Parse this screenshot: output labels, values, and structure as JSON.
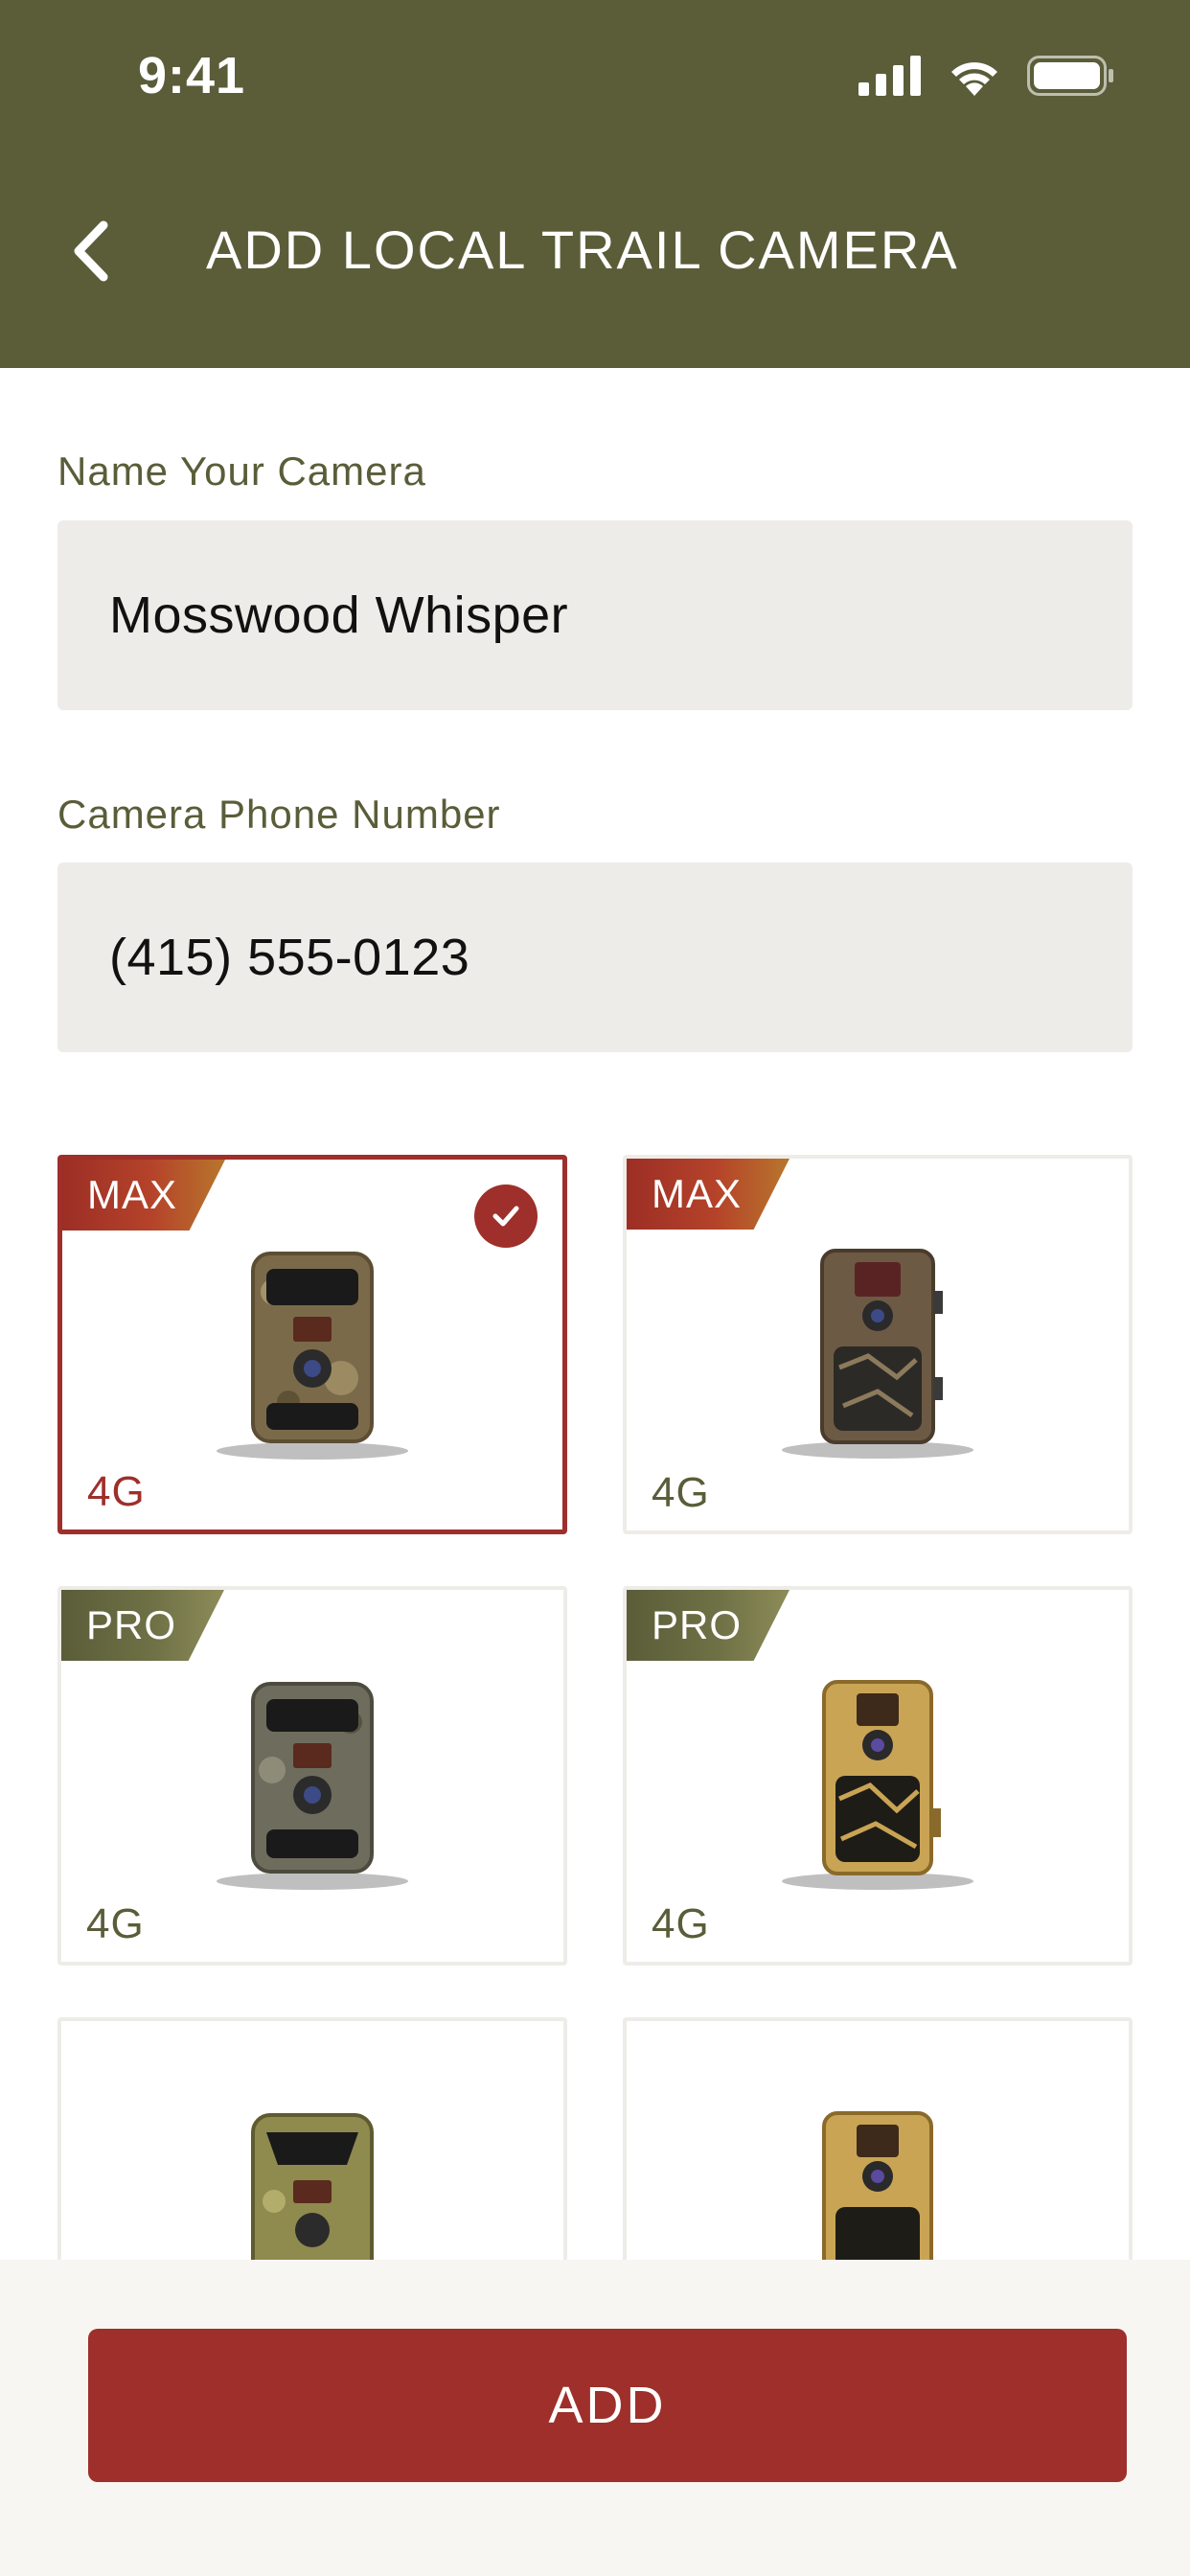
{
  "status_bar": {
    "time": "9:41"
  },
  "header": {
    "title": "ADD LOCAL TRAIL CAMERA"
  },
  "form": {
    "name_label": "Name Your Camera",
    "name_value": "Mosswood Whisper",
    "phone_label": "Camera Phone Number",
    "phone_value": "(415) 555-0123"
  },
  "cameras": [
    {
      "badge": "MAX",
      "network": "4G",
      "selected": true
    },
    {
      "badge": "MAX",
      "network": "4G",
      "selected": false
    },
    {
      "badge": "PRO",
      "network": "4G",
      "selected": false
    },
    {
      "badge": "PRO",
      "network": "4G",
      "selected": false
    },
    {
      "badge": "",
      "network": "",
      "selected": false
    },
    {
      "badge": "",
      "network": "",
      "selected": false
    }
  ],
  "footer": {
    "add_label": "ADD"
  },
  "colors": {
    "header": "#5a5d38",
    "accent": "#9e2f2a",
    "field_bg": "#eeece8"
  },
  "icons": [
    "back-chevron-icon",
    "signal-icon",
    "wifi-icon",
    "battery-icon",
    "check-icon"
  ]
}
